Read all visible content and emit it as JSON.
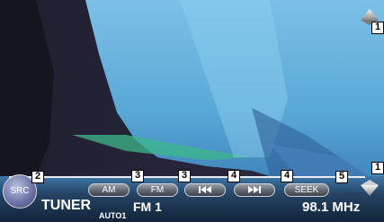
{
  "callouts": {
    "up": "1",
    "down": "1",
    "src": "2",
    "am": "3",
    "fm": "3",
    "prev": "4",
    "next": "4",
    "seek": "5"
  },
  "controls": {
    "src_label": "SRC",
    "am_label": "AM",
    "fm_label": "FM",
    "seek_label": "SEEK",
    "prev_icon": "skip-previous-icon",
    "next_icon": "skip-next-icon",
    "up_icon": "arrow-up-icon",
    "down_icon": "arrow-down-icon"
  },
  "status": {
    "source": "TUNER",
    "seek_mode": "AUTO1",
    "band": "FM 1",
    "frequency": "98.1 MHz"
  },
  "colors": {
    "accent_line": "#e8eef7",
    "pill_bg": "#5f6670",
    "src_bg": "#6f76a8"
  }
}
